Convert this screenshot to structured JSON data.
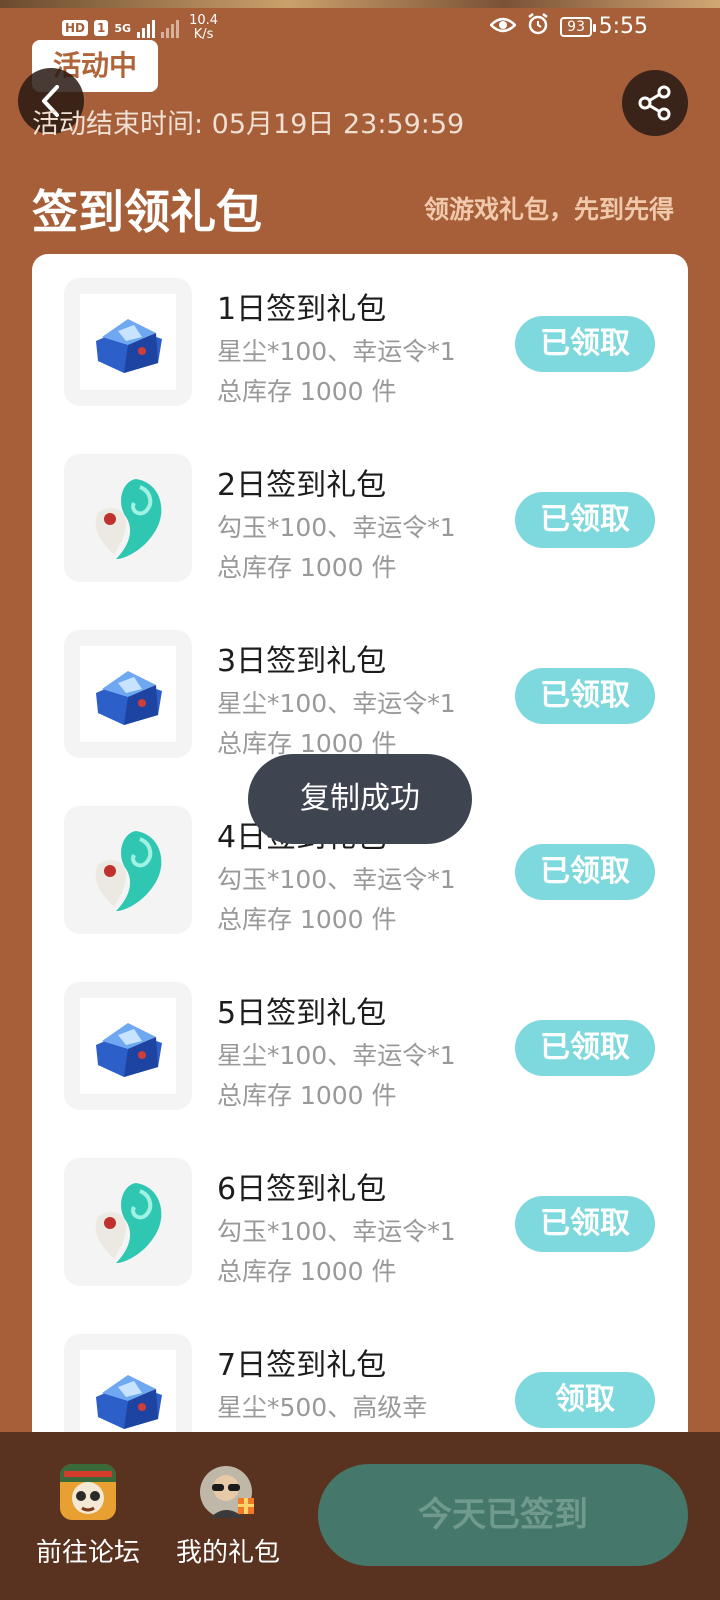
{
  "status_bar": {
    "hd_badge": "HD",
    "sim_slot": "1",
    "network_type": "5G",
    "net_speed_value": "10.4",
    "net_speed_unit": "K/s",
    "battery": "93",
    "time": "5:55"
  },
  "header": {
    "status_badge": "活动中",
    "end_time": "活动结束时间: 05月19日 23:59:59",
    "title": "签到领礼包",
    "subtitle": "领游戏礼包，先到先得"
  },
  "gifts": [
    {
      "name": "1日签到礼包",
      "content": "星尘*100、幸运令*1",
      "stock": "总库存 1000 件",
      "button": "已领取",
      "icon": "crystal-chest-icon"
    },
    {
      "name": "2日签到礼包",
      "content": "勾玉*100、幸运令*1",
      "stock": "总库存 1000 件",
      "button": "已领取",
      "icon": "magatama-icon"
    },
    {
      "name": "3日签到礼包",
      "content": "星尘*100、幸运令*1",
      "stock": "总库存 1000 件",
      "button": "已领取",
      "icon": "crystal-chest-icon"
    },
    {
      "name": "4日签到礼包",
      "content": "勾玉*100、幸运令*1",
      "stock": "总库存 1000 件",
      "button": "已领取",
      "icon": "magatama-icon"
    },
    {
      "name": "5日签到礼包",
      "content": "星尘*100、幸运令*1",
      "stock": "总库存 1000 件",
      "button": "已领取",
      "icon": "crystal-chest-icon"
    },
    {
      "name": "6日签到礼包",
      "content": "勾玉*100、幸运令*1",
      "stock": "总库存 1000 件",
      "button": "已领取",
      "icon": "magatama-icon"
    },
    {
      "name": "7日签到礼包",
      "content": "星尘*500、高级幸",
      "stock": "",
      "button": "领取",
      "icon": "crystal-chest-icon"
    }
  ],
  "toast": "复制成功",
  "bottom_bar": {
    "forum_label": "前往论坛",
    "my_gifts_label": "我的礼包",
    "signed_button": "今天已签到"
  },
  "colors": {
    "background": "#a65f38",
    "claimed_button": "#7ed9de",
    "bottom_bar": "#5a3320",
    "signed_button": "#45786b"
  }
}
